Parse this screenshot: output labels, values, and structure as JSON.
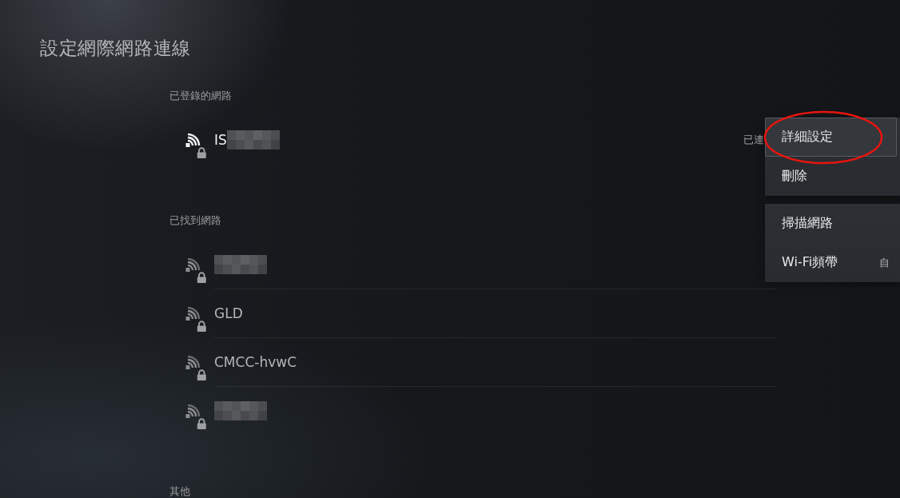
{
  "title": "設定網際網路連線",
  "sections": [
    {
      "heading": "已登錄的網路",
      "networks": [
        {
          "name": "IS",
          "redacted": true,
          "secured": true,
          "connected": true,
          "status": "已連"
        }
      ]
    },
    {
      "heading": "已找到網路",
      "networks": [
        {
          "redacted": true,
          "secured": true,
          "connected": false
        },
        {
          "name": "GLD",
          "redacted": false,
          "secured": true,
          "connected": false
        },
        {
          "name": "CMCC-hvwC",
          "redacted": false,
          "secured": true,
          "connected": false
        },
        {
          "redacted": true,
          "secured": true,
          "connected": false
        }
      ]
    },
    {
      "heading": "其他"
    }
  ],
  "menu": {
    "groups": [
      {
        "items": [
          {
            "label": "詳細設定",
            "focused": true
          },
          {
            "label": "刪除",
            "focused": false
          }
        ]
      },
      {
        "items": [
          {
            "label": "掃描網路",
            "focused": false
          },
          {
            "label": "Wi-Fi頻帶",
            "value": "自",
            "focused": false
          }
        ]
      }
    ]
  },
  "annotations": [
    {
      "kind": "ellipse"
    }
  ]
}
